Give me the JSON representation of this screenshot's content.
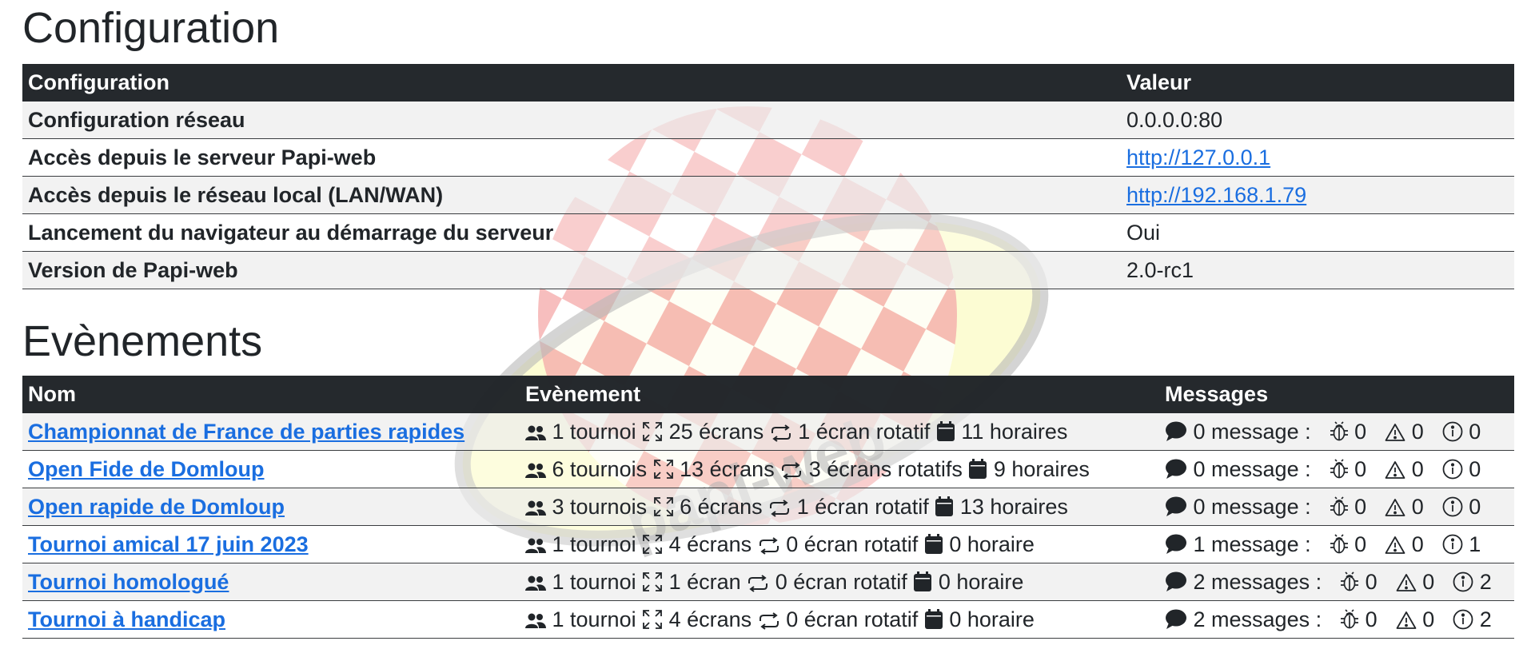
{
  "config_section": {
    "title": "Configuration",
    "columns": [
      "Configuration",
      "Valeur"
    ],
    "rows": [
      {
        "key": "Configuration réseau",
        "value": "0.0.0.0:80",
        "link": false
      },
      {
        "key": "Accès depuis le serveur Papi-web",
        "value": "http://127.0.0.1",
        "link": true
      },
      {
        "key": "Accès depuis le réseau local (LAN/WAN)",
        "value": "http://192.168.1.79",
        "link": true
      },
      {
        "key": "Lancement du navigateur au démarrage du serveur",
        "value": "Oui",
        "link": false
      },
      {
        "key": "Version de Papi-web",
        "value": "2.0-rc1",
        "link": false
      }
    ]
  },
  "events_section": {
    "title": "Evènements",
    "columns": [
      "Nom",
      "Evènement",
      "Messages"
    ],
    "rows": [
      {
        "name": "Championnat de France de parties rapides",
        "tournaments": "1 tournoi",
        "screens": "25 écrans",
        "rotators": "1 écran rotatif",
        "timers": "11 horaires",
        "messages": "0 message :",
        "errors": "0",
        "warnings": "0",
        "infos": "0"
      },
      {
        "name": "Open Fide de Domloup",
        "tournaments": "6 tournois",
        "screens": "13 écrans",
        "rotators": "3 écrans rotatifs",
        "timers": "9 horaires",
        "messages": "0 message :",
        "errors": "0",
        "warnings": "0",
        "infos": "0"
      },
      {
        "name": "Open rapide de Domloup",
        "tournaments": "3 tournois",
        "screens": "6 écrans",
        "rotators": "1 écran rotatif",
        "timers": "13 horaires",
        "messages": "0 message :",
        "errors": "0",
        "warnings": "0",
        "infos": "0"
      },
      {
        "name": "Tournoi amical 17 juin 2023",
        "tournaments": "1 tournoi",
        "screens": "4 écrans",
        "rotators": "0 écran rotatif",
        "timers": "0 horaire",
        "messages": "1 message :",
        "errors": "0",
        "warnings": "0",
        "infos": "1"
      },
      {
        "name": "Tournoi homologué",
        "tournaments": "1 tournoi",
        "screens": "1 écran",
        "rotators": "0 écran rotatif",
        "timers": "0 horaire",
        "messages": "2 messages :",
        "errors": "0",
        "warnings": "0",
        "infos": "2"
      },
      {
        "name": "Tournoi à handicap",
        "tournaments": "1 tournoi",
        "screens": "4 écrans",
        "rotators": "0 écran rotatif",
        "timers": "0 horaire",
        "messages": "2 messages :",
        "errors": "0",
        "warnings": "0",
        "infos": "2"
      }
    ]
  },
  "watermark": {
    "text": "papi-web"
  },
  "icons": {
    "tournaments": "people-icon",
    "screens": "fullscreen-icon",
    "rotators": "repeat-icon",
    "timers": "calendar-icon",
    "messages": "chat-bubble-icon",
    "errors": "bug-icon",
    "warnings": "warning-icon",
    "infos": "info-icon"
  },
  "colors": {
    "header_bg": "#212529",
    "link": "#1a6ee0",
    "stripe": "#ededed"
  }
}
